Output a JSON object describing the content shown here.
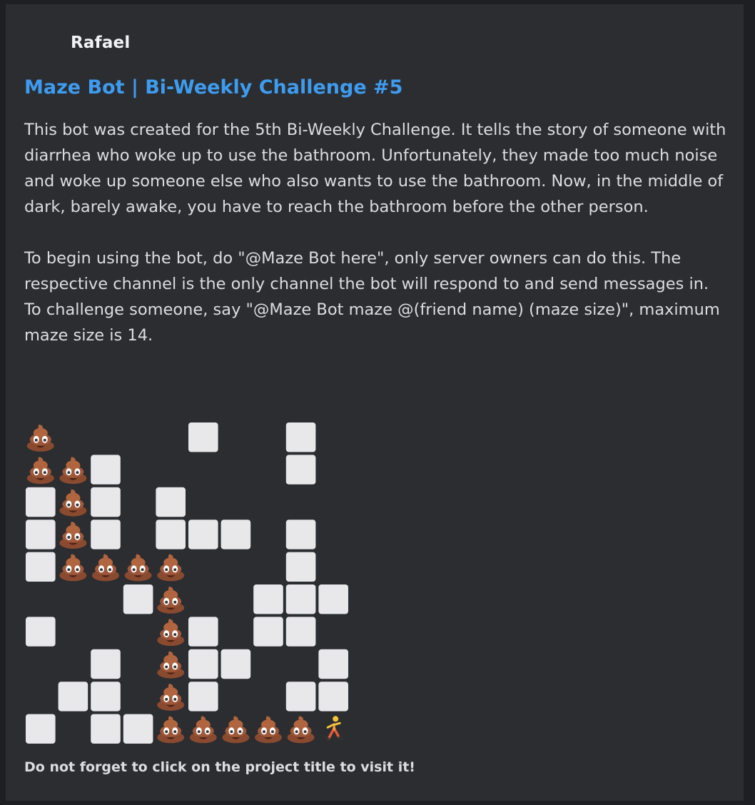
{
  "author": {
    "name": "Rafael"
  },
  "embed": {
    "title": "Maze Bot | Bi-Weekly Challenge #5",
    "description": "This bot was created for the 5th Bi-Weekly Challenge. It tells the story of someone with diarrhea who woke up to use the bathroom. Unfortunately, they made too much noise and woke up someone else who also wants to use the bathroom. Now, in the middle of dark, barely awake, you have to reach the bathroom before the other person.\n\nTo begin using the bot, do \"@Maze Bot here\", only server owners can do this. The respective channel is the only channel the bot will respond to and send messages in.\nTo challenge someone, say \"@Maze Bot maze @(friend name) (maze size)\", maximum maze size is 14.",
    "footer": "Do not forget to click on the project title to visit it!"
  },
  "maze": {
    "size": 10,
    "wall_color": "#e8e8ea",
    "floor_color": "#2b2d31",
    "trail_icon": "poop-emoji-icon",
    "runner_icon": "running-person-icon",
    "walls": [
      [
        0,
        5
      ],
      [
        0,
        8
      ],
      [
        1,
        2
      ],
      [
        1,
        8
      ],
      [
        2,
        0
      ],
      [
        2,
        2
      ],
      [
        2,
        4
      ],
      [
        3,
        0
      ],
      [
        3,
        2
      ],
      [
        3,
        4
      ],
      [
        3,
        5
      ],
      [
        3,
        6
      ],
      [
        3,
        8
      ],
      [
        4,
        0
      ],
      [
        4,
        8
      ],
      [
        5,
        3
      ],
      [
        5,
        7
      ],
      [
        5,
        8
      ],
      [
        5,
        9
      ],
      [
        6,
        0
      ],
      [
        6,
        5
      ],
      [
        6,
        7
      ],
      [
        6,
        8
      ],
      [
        7,
        2
      ],
      [
        7,
        5
      ],
      [
        7,
        6
      ],
      [
        7,
        9
      ],
      [
        8,
        1
      ],
      [
        8,
        2
      ],
      [
        8,
        5
      ],
      [
        8,
        8
      ],
      [
        8,
        9
      ],
      [
        9,
        0
      ],
      [
        9,
        2
      ],
      [
        9,
        3
      ]
    ],
    "trail": [
      [
        0,
        0
      ],
      [
        1,
        0
      ],
      [
        1,
        1
      ],
      [
        2,
        1
      ],
      [
        3,
        1
      ],
      [
        4,
        1
      ],
      [
        4,
        2
      ],
      [
        4,
        3
      ],
      [
        4,
        4
      ],
      [
        5,
        4
      ],
      [
        6,
        4
      ],
      [
        7,
        4
      ],
      [
        8,
        4
      ],
      [
        9,
        4
      ],
      [
        9,
        5
      ],
      [
        9,
        6
      ],
      [
        9,
        7
      ],
      [
        9,
        8
      ]
    ],
    "runner": [
      9,
      9
    ]
  }
}
